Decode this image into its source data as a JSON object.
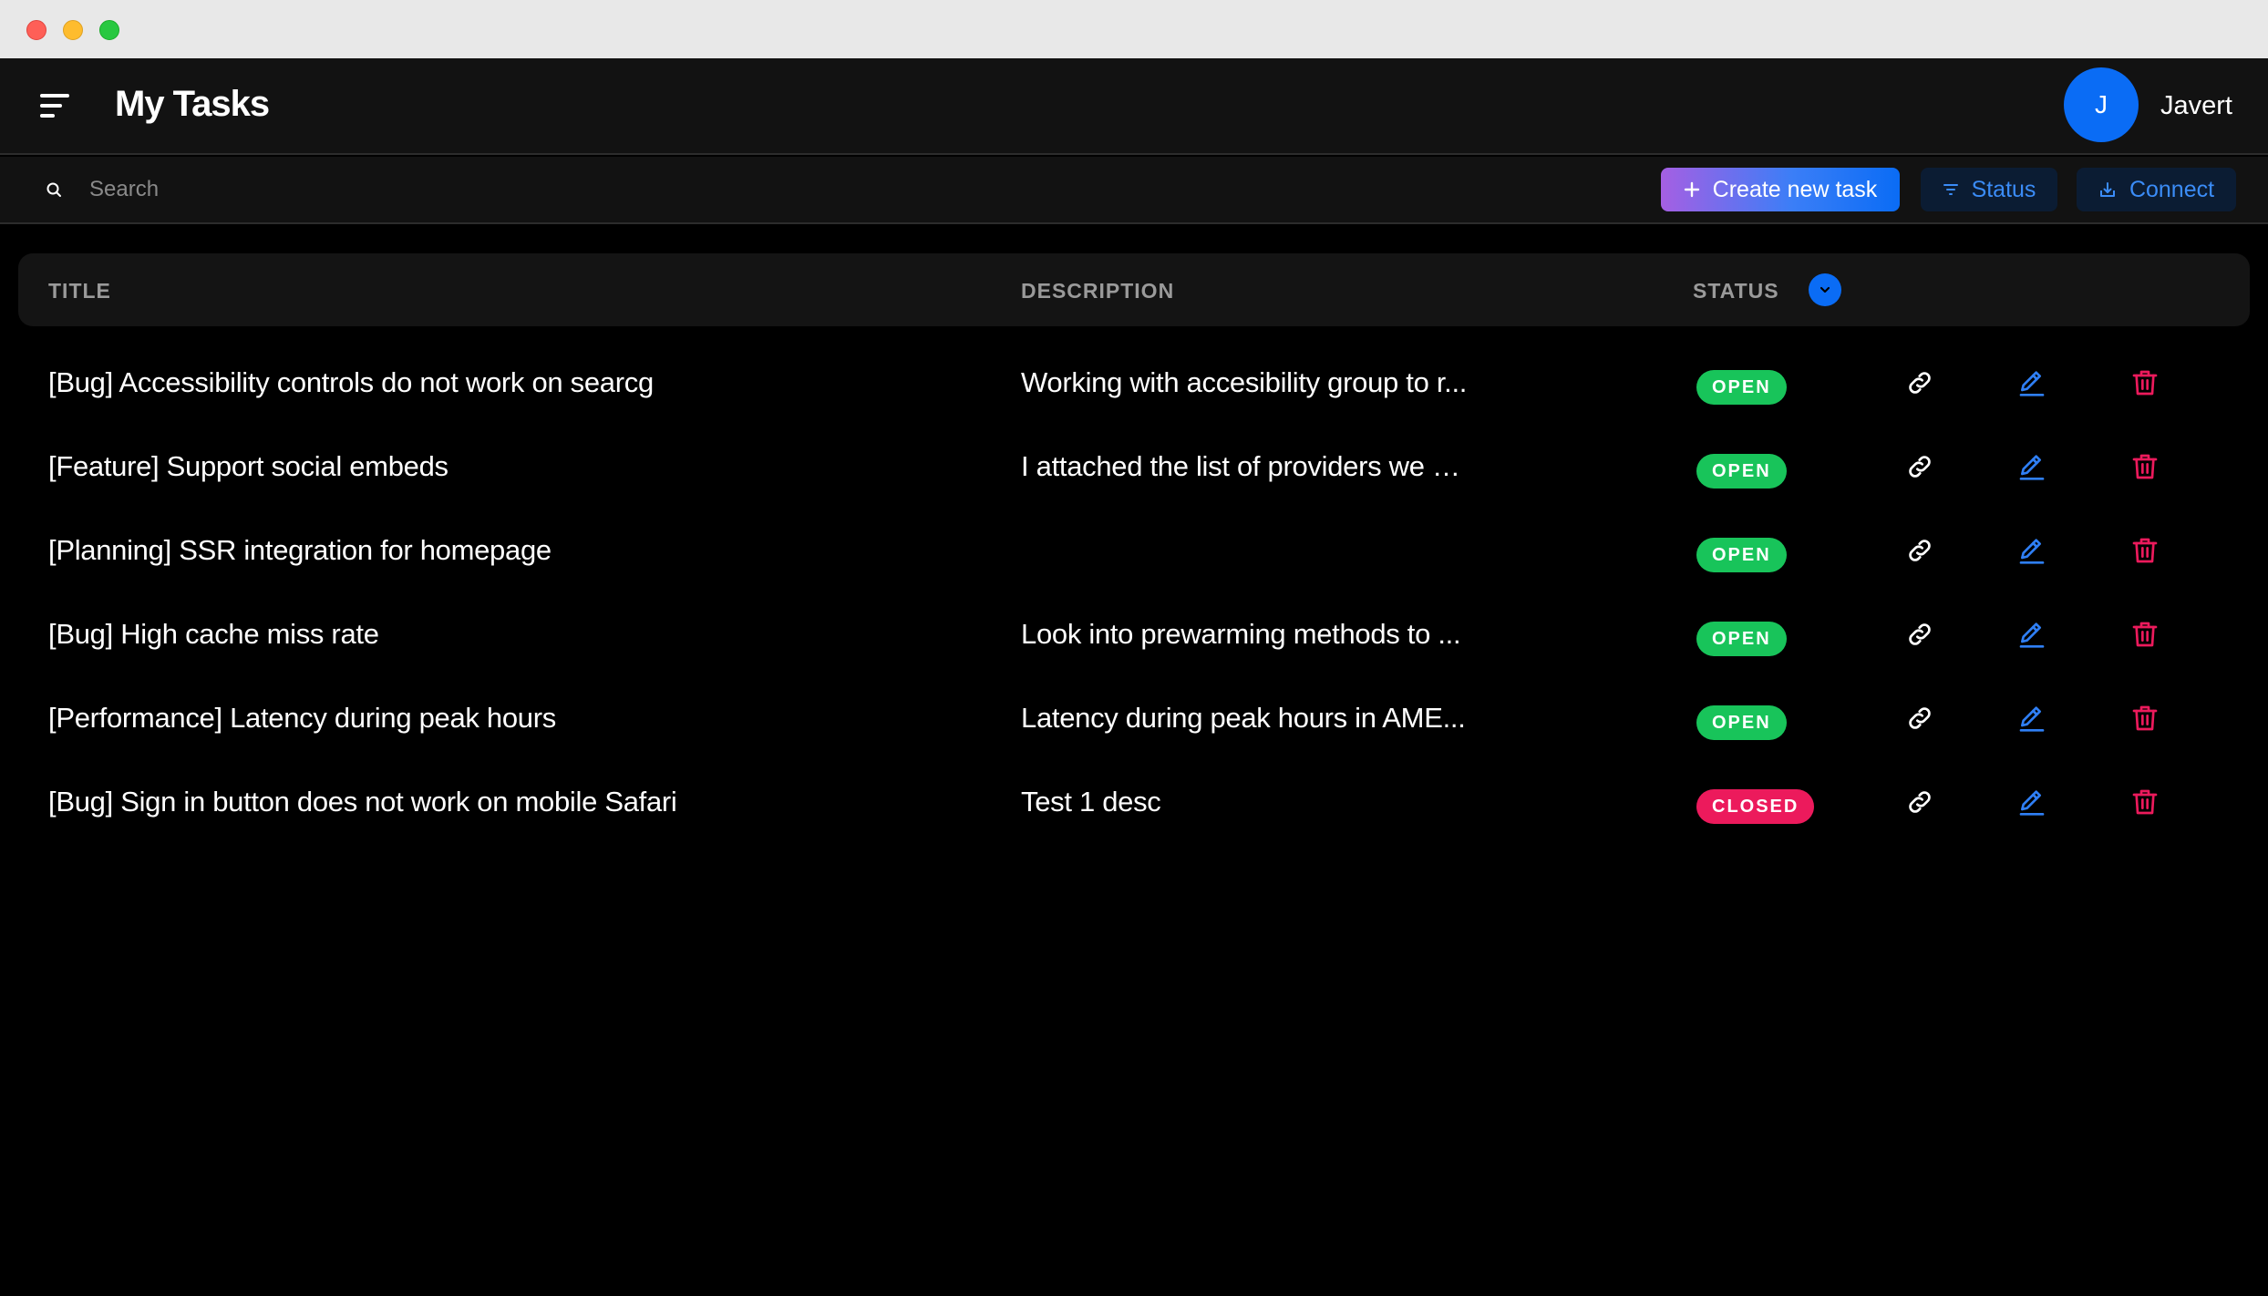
{
  "header": {
    "title": "My Tasks",
    "user": {
      "initial": "J",
      "name": "Javert"
    }
  },
  "toolbar": {
    "search_placeholder": "Search",
    "create_label": "Create new task",
    "status_label": "Status",
    "connect_label": "Connect"
  },
  "table": {
    "columns": {
      "title": "TITLE",
      "description": "DESCRIPTION",
      "status": "STATUS"
    },
    "rows": [
      {
        "title": "[Bug] Accessibility controls do not work on searcg",
        "description": "Working with accesibility group to r...",
        "status": "OPEN"
      },
      {
        "title": "[Feature] Support social embeds",
        "description": "I attached the list of providers we w...",
        "status": "OPEN"
      },
      {
        "title": "[Planning] SSR integration for homepage",
        "description": "",
        "status": "OPEN"
      },
      {
        "title": "[Bug] High cache miss rate",
        "description": "Look into prewarming methods to ...",
        "status": "OPEN"
      },
      {
        "title": "[Performance] Latency during peak hours",
        "description": "Latency during peak hours in AME...",
        "status": "OPEN"
      },
      {
        "title": "[Bug] Sign in button does not work on mobile Safari",
        "description": "Test 1 desc",
        "status": "CLOSED"
      }
    ]
  },
  "icons": {
    "menu": "menu-icon",
    "search": "search-icon",
    "plus": "plus-icon",
    "filter": "filter-icon",
    "connect": "download-icon",
    "sort": "chevron-down-icon",
    "row_actions": [
      "link-icon",
      "edit-icon",
      "trash-icon"
    ]
  },
  "colors": {
    "accent": "#0a6cf5",
    "open": "#18c45a",
    "closed": "#ec1a5c",
    "delete": "#ec1a5c"
  }
}
